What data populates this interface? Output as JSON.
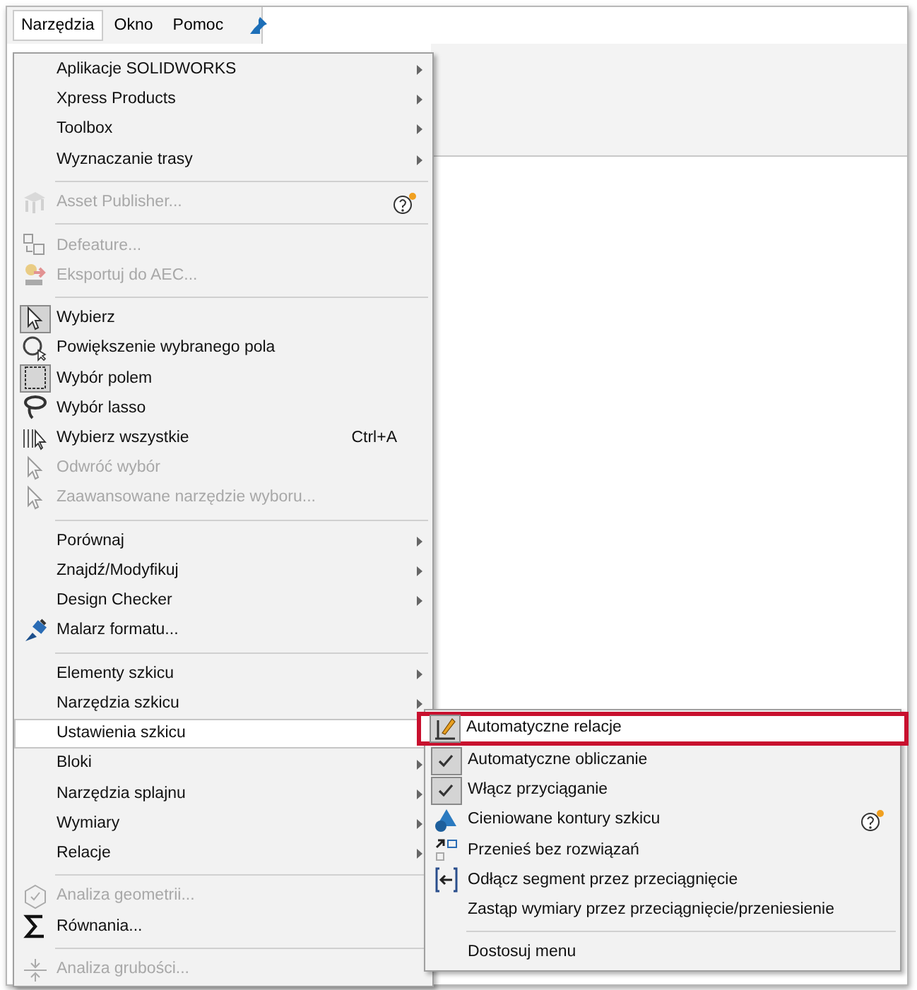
{
  "menubar": [
    {
      "label": "Narzędzia",
      "selected": true
    },
    {
      "label": "Okno",
      "selected": false
    },
    {
      "label": "Pomoc",
      "selected": false
    }
  ],
  "menu": {
    "items": [
      {
        "kind": "item",
        "label": "Aplikacje SOLIDWORKS",
        "disabled": false,
        "selected": false,
        "checked": false,
        "submenu": true
      },
      {
        "kind": "item",
        "label": "Xpress Products",
        "disabled": false,
        "selected": false,
        "checked": false,
        "submenu": true
      },
      {
        "kind": "item",
        "label": "Toolbox",
        "disabled": false,
        "selected": false,
        "checked": false,
        "submenu": true
      },
      {
        "kind": "item",
        "label": "Wyznaczanie trasy",
        "disabled": false,
        "selected": false,
        "checked": false,
        "submenu": true
      },
      {
        "kind": "separator"
      },
      {
        "kind": "item",
        "label": "Asset Publisher...",
        "disabled": true,
        "selected": false,
        "checked": false,
        "submenu": false
      },
      {
        "kind": "separator"
      },
      {
        "kind": "item",
        "label": "Defeature...",
        "disabled": true,
        "selected": false,
        "checked": false,
        "submenu": false
      },
      {
        "kind": "item",
        "label": "Eksportuj do AEC...",
        "disabled": true,
        "selected": false,
        "checked": false,
        "submenu": false
      },
      {
        "kind": "separator"
      },
      {
        "kind": "item",
        "label": "Wybierz",
        "disabled": false,
        "selected": false,
        "checked": true,
        "submenu": false
      },
      {
        "kind": "item",
        "label": "Powiększenie wybranego pola",
        "disabled": false,
        "selected": false,
        "checked": false,
        "submenu": false
      },
      {
        "kind": "item",
        "label": "Wybór polem",
        "disabled": false,
        "selected": false,
        "checked": true,
        "submenu": false
      },
      {
        "kind": "item",
        "label": "Wybór lasso",
        "disabled": false,
        "selected": false,
        "checked": false,
        "submenu": false
      },
      {
        "kind": "item",
        "label": "Wybierz wszystkie",
        "shortcut": "Ctrl+A",
        "disabled": false,
        "selected": false,
        "checked": false,
        "submenu": false
      },
      {
        "kind": "item",
        "label": "Odwróć wybór",
        "disabled": true,
        "selected": false,
        "checked": false,
        "submenu": false
      },
      {
        "kind": "item",
        "label": "Zaawansowane narzędzie wyboru...",
        "disabled": true,
        "selected": false,
        "checked": false,
        "submenu": false
      },
      {
        "kind": "separator"
      },
      {
        "kind": "item",
        "label": "Porównaj",
        "disabled": false,
        "selected": false,
        "checked": false,
        "submenu": true
      },
      {
        "kind": "item",
        "label": "Znajdź/Modyfikuj",
        "disabled": false,
        "selected": false,
        "checked": false,
        "submenu": true
      },
      {
        "kind": "item",
        "label": "Design Checker",
        "disabled": false,
        "selected": false,
        "checked": false,
        "submenu": true
      },
      {
        "kind": "item",
        "label": "Malarz formatu...",
        "disabled": false,
        "selected": false,
        "checked": false,
        "submenu": false
      },
      {
        "kind": "separator"
      },
      {
        "kind": "item",
        "label": "Elementy szkicu",
        "disabled": false,
        "selected": false,
        "checked": false,
        "submenu": true
      },
      {
        "kind": "item",
        "label": "Narzędzia szkicu",
        "disabled": false,
        "selected": false,
        "checked": false,
        "submenu": true
      },
      {
        "kind": "item",
        "label": "Ustawienia szkicu",
        "disabled": false,
        "selected": true,
        "checked": false,
        "submenu": true
      },
      {
        "kind": "item",
        "label": "Bloki",
        "disabled": false,
        "selected": false,
        "checked": false,
        "submenu": true
      },
      {
        "kind": "item",
        "label": "Narzędzia splajnu",
        "disabled": false,
        "selected": false,
        "checked": false,
        "submenu": true
      },
      {
        "kind": "item",
        "label": "Wymiary",
        "disabled": false,
        "selected": false,
        "checked": false,
        "submenu": true
      },
      {
        "kind": "item",
        "label": "Relacje",
        "disabled": false,
        "selected": false,
        "checked": false,
        "submenu": true
      },
      {
        "kind": "separator"
      },
      {
        "kind": "item",
        "label": "Analiza geometrii...",
        "disabled": true,
        "selected": false,
        "checked": false,
        "submenu": false
      },
      {
        "kind": "item",
        "label": "Równania...",
        "disabled": false,
        "selected": false,
        "checked": false,
        "submenu": false
      },
      {
        "kind": "separator"
      },
      {
        "kind": "item",
        "label": "Analiza grubości...",
        "disabled": true,
        "selected": false,
        "checked": false,
        "submenu": false
      }
    ]
  },
  "submenu": {
    "items": [
      {
        "kind": "item",
        "label": "Automatyczne relacje",
        "checked": true,
        "outlined": true
      },
      {
        "kind": "item",
        "label": "Automatyczne obliczanie",
        "checked": true,
        "outlined": false
      },
      {
        "kind": "item",
        "label": "Włącz przyciąganie",
        "checked": true,
        "outlined": false
      },
      {
        "kind": "item",
        "label": "Cieniowane kontury szkicu",
        "checked": false,
        "outlined": false
      },
      {
        "kind": "item",
        "label": "Przenieś bez rozwiązań",
        "checked": false,
        "outlined": false
      },
      {
        "kind": "item",
        "label": "Odłącz segment przez przeciągnięcie",
        "checked": false,
        "outlined": false
      },
      {
        "kind": "item",
        "label": "Zastąp wymiary przez przeciągnięcie/przeniesienie",
        "checked": false,
        "outlined": false
      },
      {
        "kind": "separator"
      },
      {
        "kind": "item",
        "label": "Dostosuj menu",
        "checked": false,
        "outlined": false
      }
    ]
  }
}
